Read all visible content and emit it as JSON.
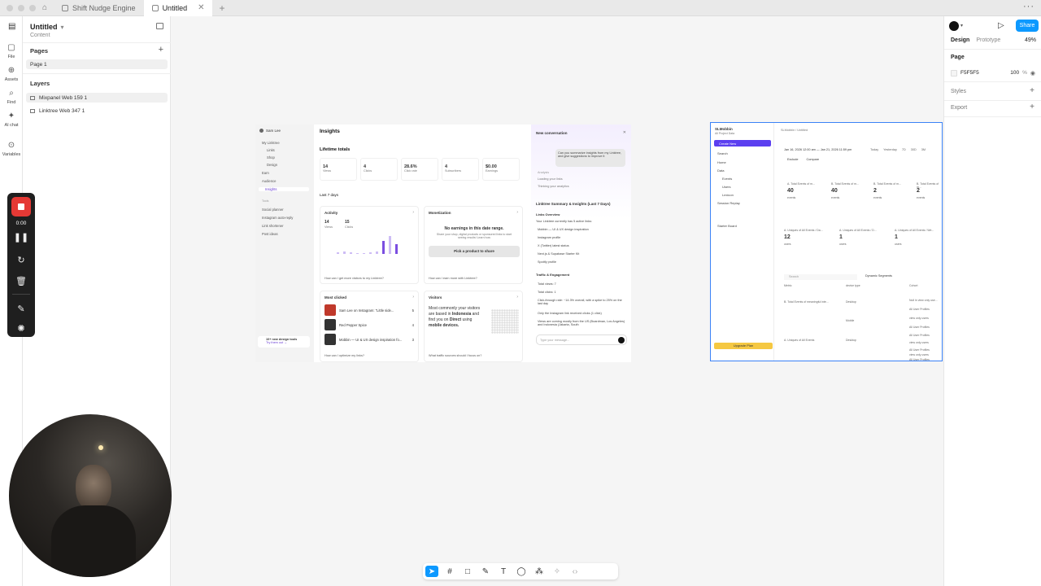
{
  "tabs": [
    {
      "label": "Shift Nudge Engine"
    },
    {
      "label": "Untitled"
    }
  ],
  "rail": [
    {
      "label": "File",
      "icon": "file-icon"
    },
    {
      "label": "Assets",
      "icon": "assets-icon"
    },
    {
      "label": "Find",
      "icon": "find-icon"
    },
    {
      "label": "AI chat",
      "icon": "ai-chat-icon"
    },
    {
      "label": "Variables",
      "icon": "variables-icon"
    }
  ],
  "left_panel": {
    "title": "Untitled",
    "subtitle": "Content",
    "pages_header": "Pages",
    "pages": [
      "Page 1"
    ],
    "layers_header": "Layers",
    "layers": [
      "Mixpanel Web 159 1",
      "Linktree Web 347 1"
    ]
  },
  "linktree": {
    "user": "Sam Lee",
    "nav": [
      "My Linktree",
      "Links",
      "Shop",
      "Design",
      "Earn",
      "Audience",
      "Insights",
      "Tools",
      "Social planner",
      "Instagram auto-reply",
      "Link shortener",
      "Post ideas"
    ],
    "title": "Insights",
    "lifetime": "Lifetime totals",
    "stats": [
      {
        "value": "14",
        "label": "Views"
      },
      {
        "value": "4",
        "label": "Clicks"
      },
      {
        "value": "28.6%",
        "label": "Click rate"
      },
      {
        "value": "4",
        "label": "Subscribers"
      },
      {
        "value": "$0.00",
        "label": "Earnings"
      }
    ],
    "range": "Last 7 days",
    "activity": {
      "title": "Activity",
      "views": "14",
      "views_label": "Views",
      "clicks": "15",
      "clicks_label": "Clicks",
      "footer": "How can I get more visitors to my Linktree?"
    },
    "monetization": {
      "title": "Monetization",
      "empty": "No earnings in this date range.",
      "desc": "Share your shop, digital products or sponsored links to start seeing results! Learn how",
      "button": "Pick a product to share",
      "footer": "How can I earn more with Linktree?"
    },
    "most_clicked": {
      "title": "Most clicked",
      "rows": [
        {
          "label": "Sam Lee on Instagram: \"Little side...",
          "count": "5"
        },
        {
          "label": "Red Pepper Spice",
          "count": "4"
        },
        {
          "label": "Mobbin — UI & UX design inspiration fo...",
          "count": "3"
        }
      ],
      "footer": "How can I optimize my links?"
    },
    "visitors": {
      "title": "Visitors",
      "line1": "Most commonly your visitors are based in",
      "country": "Indonesia",
      "line2": "and find you on",
      "source": "Direct",
      "line3": "using",
      "device": "mobile devices.",
      "footer": "What traffic sources should I focus on?"
    },
    "promo": {
      "title": "10+ new design tools",
      "link": "Try them out →"
    },
    "chat": {
      "header": "New conversation",
      "bubble": "Can you summarize insights from my Linktree, and give suggestions to improve it",
      "steps": [
        "Analysis",
        "Loading your links",
        "Thinking your analytics"
      ],
      "summary_title": "Linktree Summary & Insights (Last 7 Days)",
      "links_title": "Links Overview",
      "links_intro": "Your Linktree currently has 5 active links:",
      "links": [
        "Mobbin — UI & UX design inspiration",
        "Instagram profile",
        "X (Twitter) latest status",
        "Next.js & Supabase Starter Kit",
        "Spotify profile"
      ],
      "traffic_title": "Traffic & Engagement",
      "traffic": [
        "Total views: 7",
        "Total clicks: 1",
        "Click-through rate: ~14.3% overall, with a spike to 25% on the last day",
        "Only the Instagram link received clicks (1 click)",
        "Views are coming mostly from the US (Boardman, Los Angeles) and Indonesia (Jakarta, South"
      ],
      "input_placeholder": "Type your message..."
    }
  },
  "mixpanel": {
    "brand": "SLMobbin",
    "project": "All Project Data",
    "create": "Create New",
    "nav": [
      "Search",
      "Home",
      "Data",
      "Events",
      "Users",
      "Lexicon",
      "Session Replay",
      "Starter Board"
    ],
    "breadcrumb": "SLMobbin / Untitled",
    "date": "Jan 16, 2026 12:00 am — Jan 21, 2026 11:59 pm",
    "chips": [
      "Today",
      "Yesterday",
      "7D",
      "30D",
      "3M"
    ],
    "filters": [
      "Exclude",
      "Compare"
    ],
    "metrics": [
      {
        "label": "A. Total Events of m...",
        "value": "40",
        "unit": "events"
      },
      {
        "label": "B. Total Events of m...",
        "value": "40",
        "unit": "events"
      },
      {
        "label": "B. Total Events of m...",
        "value": "2",
        "unit": "events"
      },
      {
        "label": "B. Total Events of m...",
        "value": "2",
        "unit": "events"
      },
      {
        "label": "A. Uniques of All Events / Da...",
        "value": "12",
        "unit": "users"
      },
      {
        "label": "A. Uniques of All Events / D...",
        "value": "1",
        "unit": "users"
      },
      {
        "label": "A. Uniques of All Events / We...",
        "value": "1",
        "unit": "users"
      }
    ],
    "search": "Search",
    "segments": "Dynamic Segments",
    "columns": [
      "Metric",
      "device type",
      "Cohort"
    ],
    "rows": [
      "B. Total Events of meaningful inte...",
      "A. Uniques of All Events"
    ],
    "devices": [
      "Desktop",
      "Mobile",
      "Desktop"
    ],
    "cohorts": [
      "Null in view only use...",
      "All User Profiles",
      "view only users",
      "All User Profiles",
      "All User Profiles",
      "view only users",
      "All User Profiles",
      "view only users",
      "All User Profiles"
    ],
    "upgrade": "Upgrade Plan"
  },
  "right_panel": {
    "share": "Share",
    "tab_design": "Design",
    "tab_prototype": "Prototype",
    "zoom": "49%",
    "page_header": "Page",
    "fill_hex": "F5F5F5",
    "fill_opacity": "100",
    "fill_unit": "%",
    "styles": "Styles",
    "export": "Export"
  },
  "recorder": {
    "time": "0:00"
  },
  "colors": {
    "accent": "#0d99ff",
    "record": "#e53935",
    "mixpanel_purple": "#5b3ff0",
    "linktree_purple": "#6b3fd4"
  }
}
